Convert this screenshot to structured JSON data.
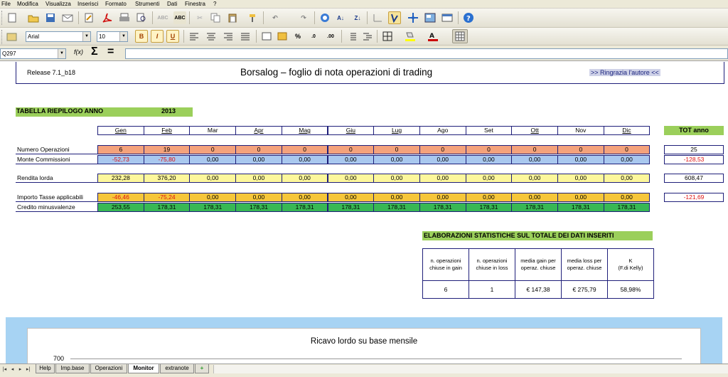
{
  "menu": [
    "File",
    "Modifica",
    "Visualizza",
    "Inserisci",
    "Formato",
    "Strumenti",
    "Dati",
    "Finestra",
    "?"
  ],
  "toolbar2": {
    "font_name": "Arial",
    "font_size": "10",
    "bold": "B",
    "italic": "I",
    "underline": "U"
  },
  "formula_bar": {
    "cell_ref": "Q297",
    "fx": "f(x)",
    "sum": "Σ",
    "equals": "=",
    "content": ""
  },
  "header": {
    "release": "Release 7.1_b18",
    "title": "Borsalog – foglio di nota operazioni di trading",
    "thanks": ">> Ringrazia l'autore <<"
  },
  "summary": {
    "title": "TABELLA RIEPILOGO ANNO",
    "year": "2013",
    "months": [
      "Gen",
      "Feb",
      "Mar",
      "Apr",
      "Mag",
      "Giu",
      "Lug",
      "Ago",
      "Set",
      "Ott",
      "Nov",
      "Dic"
    ],
    "tot_label": "TOT anno",
    "rows": [
      {
        "label": "Numero Operazioni",
        "values": [
          "6",
          "19",
          "0",
          "0",
          "0",
          "0",
          "0",
          "0",
          "0",
          "0",
          "0",
          "0"
        ],
        "total": "25",
        "color": "#f4a27c"
      },
      {
        "label": "Monte Commissioni",
        "values": [
          "-52,73",
          "-75,80",
          "0,00",
          "0,00",
          "0,00",
          "0,00",
          "0,00",
          "0,00",
          "0,00",
          "0,00",
          "0,00",
          "0,00"
        ],
        "total": "-128,53",
        "color": "#a9c8ef"
      },
      {
        "label": "Rendita lorda",
        "values": [
          "232,28",
          "376,20",
          "0,00",
          "0,00",
          "0,00",
          "0,00",
          "0,00",
          "0,00",
          "0,00",
          "0,00",
          "0,00",
          "0,00"
        ],
        "total": "608,47",
        "color": "#fdf79b"
      },
      {
        "label": "Importo Tasse applicabili",
        "values": [
          "-46,46",
          "-75,24",
          "0,00",
          "0,00",
          "0,00",
          "0,00",
          "0,00",
          "0,00",
          "0,00",
          "0,00",
          "0,00",
          "0,00"
        ],
        "total": "-121,69",
        "color": "#f6c63a"
      },
      {
        "label": "Credito minusvalenze",
        "values": [
          "253,55",
          "178,31",
          "178,31",
          "178,31",
          "178,31",
          "178,31",
          "178,31",
          "178,31",
          "178,31",
          "178,31",
          "178,31",
          "178,31"
        ],
        "total": "",
        "color": "#38b854"
      }
    ]
  },
  "stats": {
    "title": "ELABORAZIONI STATISTICHE SUL TOTALE DEI DATI INSERITI",
    "headers": [
      [
        "n. operazioni",
        "chiuse in gain"
      ],
      [
        "n. operazioni",
        "chiuse in loss"
      ],
      [
        "media gain per",
        "operaz. chiuse"
      ],
      [
        "media loss per",
        "operaz. chiuse"
      ],
      [
        "K",
        "(F.di Kelly)"
      ]
    ],
    "values": [
      "6",
      "1",
      "€ 147,38",
      "€ 275,79",
      "58,98%"
    ]
  },
  "chart": {
    "title": "Ricavo lordo su base mensile",
    "y_tick": "700"
  },
  "tabs": [
    "Help",
    "Imp.base",
    "Operazioni",
    "Monitor",
    "extranote"
  ],
  "active_tab": "Monitor",
  "colors": {
    "green_header": "#9bcf5b",
    "border": "#1f1f7a",
    "chart_bg": "#a7d3f3"
  }
}
